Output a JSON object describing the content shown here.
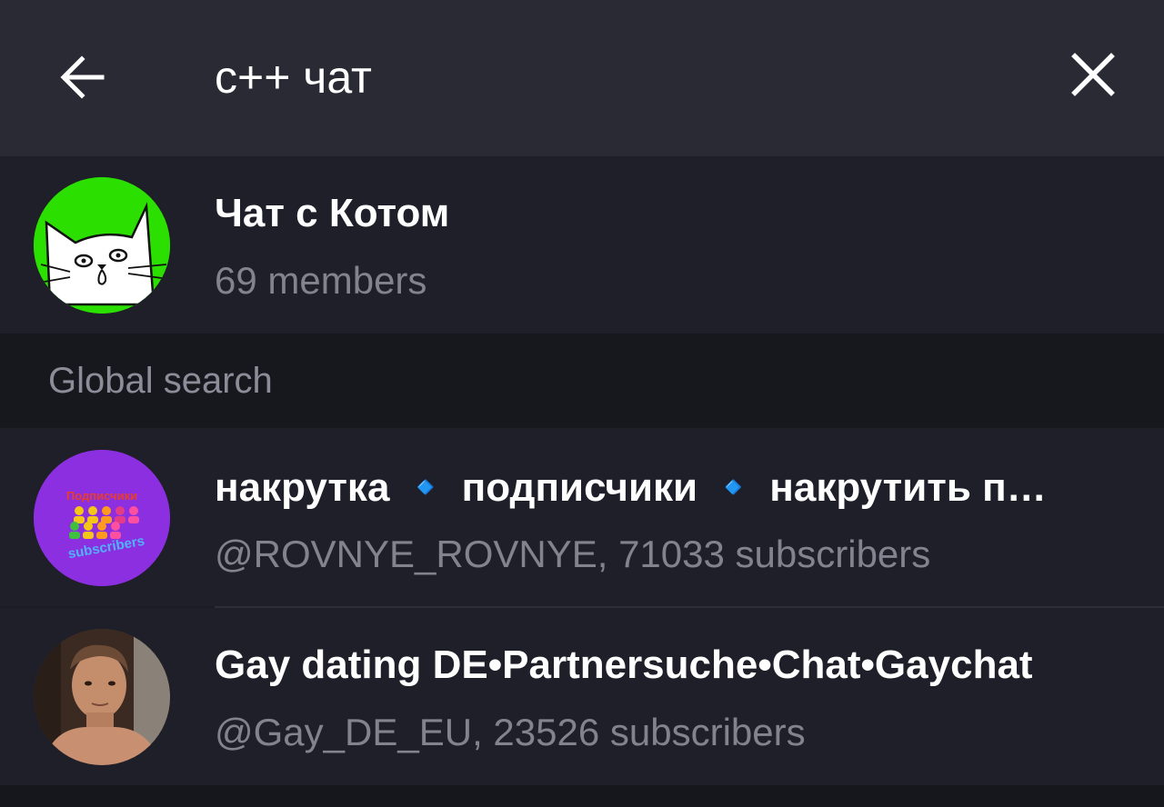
{
  "header": {
    "back_icon": "arrow-left-icon",
    "search_value": "c++ чат",
    "clear_icon": "close-icon"
  },
  "local_results": [
    {
      "title": "Чат с Котом",
      "subtitle": "69 members",
      "avatar_icon": "cat-avatar",
      "avatar_color": "#2be000"
    }
  ],
  "global_search": {
    "label": "Global search",
    "results": [
      {
        "title": "накрутка 🔹 подписчики 🔹 накрутить подписчиков",
        "subtitle": "@ROVNYE_ROVNYE, 71033 subscribers",
        "avatar_icon": "subscribers-avatar",
        "avatar_color": "#8c2fe0",
        "avatar_text_top": "Подписчики",
        "avatar_text_bottom": "subscribers"
      },
      {
        "title": "Gay dating DE•Partnersuche•Chat•Gaychat",
        "subtitle": "@Gay_DE_EU, 23526 subscribers",
        "avatar_icon": "photo-avatar",
        "avatar_color": "#5a4030"
      }
    ]
  },
  "colors": {
    "header_bg": "#2a2a35",
    "row_bg": "#1f1f29",
    "section_bg": "#17171e",
    "title_text": "#ffffff",
    "subtitle_text": "#83838f"
  }
}
